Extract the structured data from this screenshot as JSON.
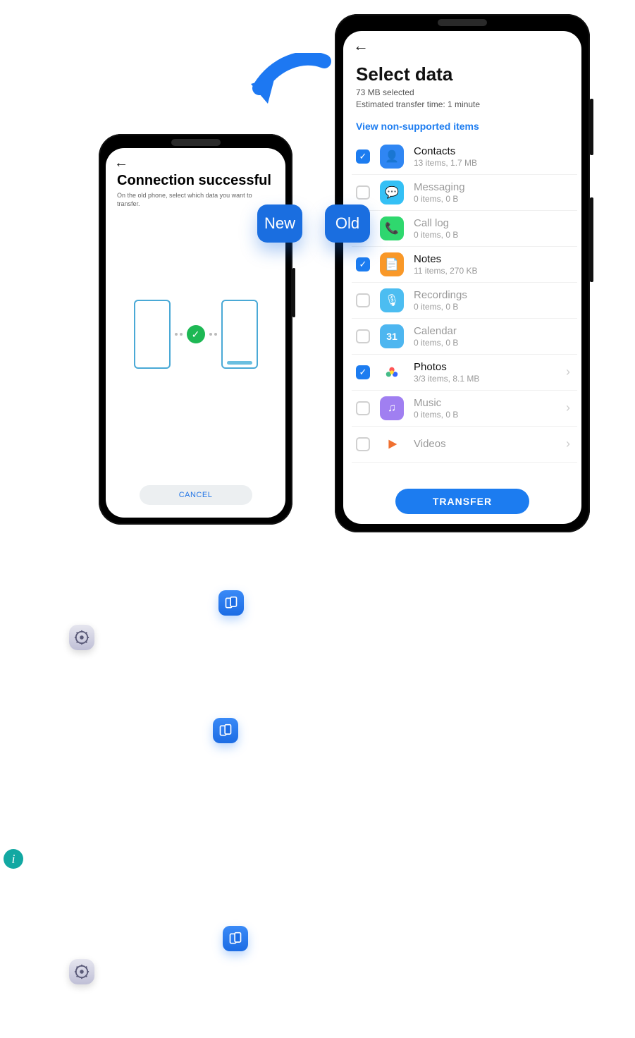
{
  "badges": {
    "new": "New",
    "old": "Old"
  },
  "left_phone": {
    "title": "Connection successful",
    "subtitle": "On the old phone, select which data you want to transfer.",
    "cancel_label": "CANCEL"
  },
  "right_phone": {
    "title": "Select data",
    "selected_summary": "73 MB selected",
    "eta": "Estimated transfer time: 1 minute",
    "link": "View non-supported items",
    "transfer_label": "TRANSFER",
    "items": [
      {
        "name": "Contacts",
        "sub": "13 items, 1.7 MB",
        "checked": true,
        "enabled": true,
        "color": "#2f86f3",
        "glyph": "👤",
        "chevron": false
      },
      {
        "name": "Messaging",
        "sub": "0 items, 0 B",
        "checked": false,
        "enabled": false,
        "color": "#34c0f5",
        "glyph": "💬",
        "chevron": false
      },
      {
        "name": "Call log",
        "sub": "0 items, 0 B",
        "checked": false,
        "enabled": false,
        "color": "#2fd86e",
        "glyph": "📞",
        "chevron": false
      },
      {
        "name": "Notes",
        "sub": "11 items, 270 KB",
        "checked": true,
        "enabled": true,
        "color": "#f99828",
        "glyph": "📄",
        "chevron": false
      },
      {
        "name": "Recordings",
        "sub": "0 items, 0 B",
        "checked": false,
        "enabled": false,
        "color": "#4cbdf1",
        "glyph": "🎙",
        "chevron": false
      },
      {
        "name": "Calendar",
        "sub": "0 items, 0 B",
        "checked": false,
        "enabled": false,
        "color": "#4db6f0",
        "glyph": "31",
        "chevron": false
      },
      {
        "name": "Photos",
        "sub": "3/3 items, 8.1 MB",
        "checked": true,
        "enabled": true,
        "color": "#ffffff",
        "glyph": "✳",
        "chevron": true,
        "multicolor": true
      },
      {
        "name": "Music",
        "sub": "0 items, 0 B",
        "checked": false,
        "enabled": false,
        "color": "#a07ff1",
        "glyph": "♫",
        "chevron": true
      },
      {
        "name": "Videos",
        "sub": "",
        "checked": false,
        "enabled": false,
        "color": "#ffffff",
        "glyph": "▶",
        "chevron": true,
        "play": true
      }
    ]
  }
}
